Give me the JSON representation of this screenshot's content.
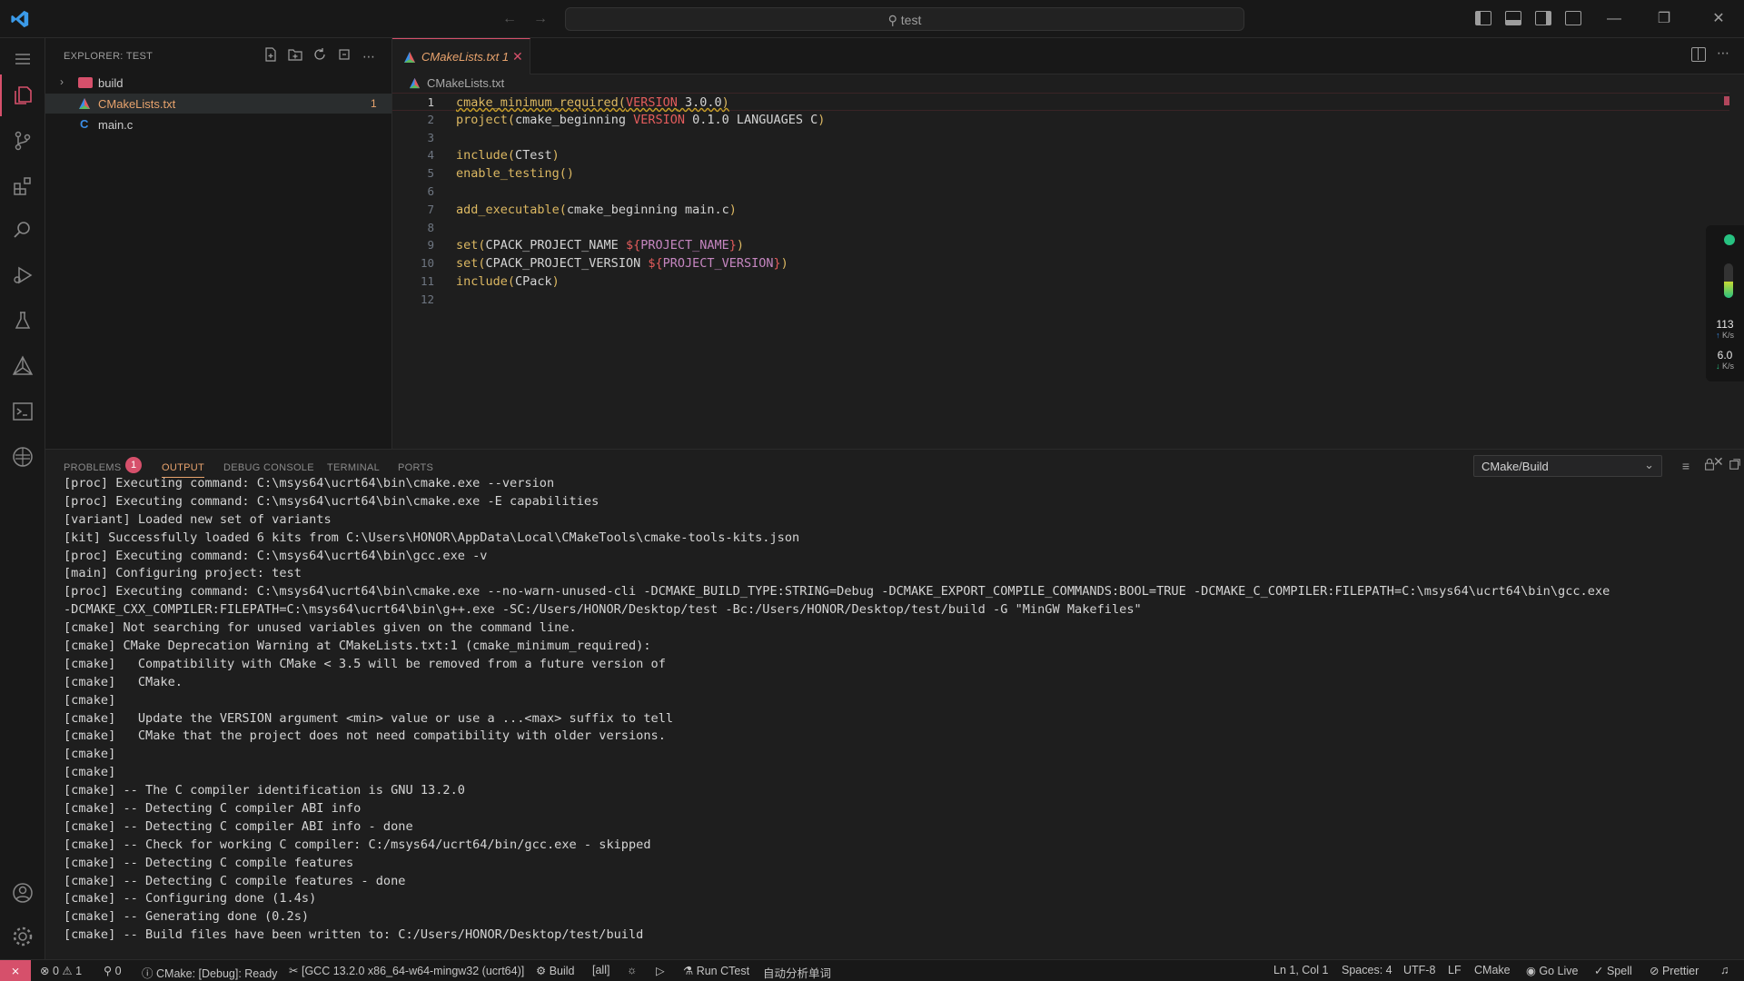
{
  "titlebar": {
    "search_text": "test",
    "nav_back": "←",
    "nav_forward": "→",
    "minimize": "—",
    "maximize": "❐",
    "close": "✕"
  },
  "sidebar": {
    "title": "EXPLORER: TEST",
    "items": [
      {
        "label": "build",
        "kind": "folder",
        "badge": ""
      },
      {
        "label": "CMakeLists.txt",
        "kind": "cmake",
        "badge": "1"
      },
      {
        "label": "main.c",
        "kind": "c",
        "badge": ""
      }
    ]
  },
  "editor": {
    "tab_label": "CMakeLists.txt 1",
    "breadcrumb": "CMakeLists.txt",
    "line_numbers": [
      "1",
      "2",
      "3",
      "4",
      "5",
      "6",
      "7",
      "8",
      "9",
      "10",
      "11",
      "12"
    ],
    "lines": [
      [
        {
          "t": "cmake_minimum_required(",
          "c": "fn"
        },
        {
          "t": "VERSION",
          "c": "kw"
        },
        {
          "t": " 3.0.0",
          "c": "pl"
        },
        {
          "t": ")",
          "c": "fn"
        }
      ],
      [
        {
          "t": "project(",
          "c": "fn"
        },
        {
          "t": "cmake_beginning ",
          "c": "pl"
        },
        {
          "t": "VERSION",
          "c": "kw"
        },
        {
          "t": " 0.1.0 LANGUAGES C",
          "c": "pl"
        },
        {
          "t": ")",
          "c": "fn"
        }
      ],
      [],
      [
        {
          "t": "include(",
          "c": "fn"
        },
        {
          "t": "CTest",
          "c": "pl"
        },
        {
          "t": ")",
          "c": "fn"
        }
      ],
      [
        {
          "t": "enable_testing()",
          "c": "fn"
        }
      ],
      [],
      [
        {
          "t": "add_executable(",
          "c": "fn"
        },
        {
          "t": "cmake_beginning main.c",
          "c": "pl"
        },
        {
          "t": ")",
          "c": "fn"
        }
      ],
      [],
      [
        {
          "t": "set(",
          "c": "fn"
        },
        {
          "t": "CPACK_PROJECT_NAME ",
          "c": "pl"
        },
        {
          "t": "${",
          "c": "kw"
        },
        {
          "t": "PROJECT_NAME",
          "c": "var"
        },
        {
          "t": "}",
          "c": "kw"
        },
        {
          "t": ")",
          "c": "fn"
        }
      ],
      [
        {
          "t": "set(",
          "c": "fn"
        },
        {
          "t": "CPACK_PROJECT_VERSION ",
          "c": "pl"
        },
        {
          "t": "${",
          "c": "kw"
        },
        {
          "t": "PROJECT_VERSION",
          "c": "var"
        },
        {
          "t": "}",
          "c": "kw"
        },
        {
          "t": ")",
          "c": "fn"
        }
      ],
      [
        {
          "t": "include(",
          "c": "fn"
        },
        {
          "t": "CPack",
          "c": "pl"
        },
        {
          "t": ")",
          "c": "fn"
        }
      ],
      []
    ]
  },
  "net_widget": {
    "upload_value": "113",
    "upload_unit": "K/s",
    "download_value": "6.0",
    "download_unit": "K/s"
  },
  "panel": {
    "tabs": [
      "PROBLEMS",
      "OUTPUT",
      "DEBUG CONSOLE",
      "TERMINAL",
      "PORTS"
    ],
    "problems_count": "1",
    "output_channel": "CMake/Build",
    "log": [
      "[proc] Executing command: C:\\msys64\\ucrt64\\bin\\cmake.exe --version",
      "[proc] Executing command: C:\\msys64\\ucrt64\\bin\\cmake.exe -E capabilities",
      "[variant] Loaded new set of variants",
      "[kit] Successfully loaded 6 kits from C:\\Users\\HONOR\\AppData\\Local\\CMakeTools\\cmake-tools-kits.json",
      "[proc] Executing command: C:\\msys64\\ucrt64\\bin\\gcc.exe -v",
      "[main] Configuring project: test",
      "[proc] Executing command: C:\\msys64\\ucrt64\\bin\\cmake.exe --no-warn-unused-cli -DCMAKE_BUILD_TYPE:STRING=Debug -DCMAKE_EXPORT_COMPILE_COMMANDS:BOOL=TRUE -DCMAKE_C_COMPILER:FILEPATH=C:\\msys64\\ucrt64\\bin\\gcc.exe",
      "-DCMAKE_CXX_COMPILER:FILEPATH=C:\\msys64\\ucrt64\\bin\\g++.exe -SC:/Users/HONOR/Desktop/test -Bc:/Users/HONOR/Desktop/test/build -G \"MinGW Makefiles\"",
      "[cmake] Not searching for unused variables given on the command line.",
      "[cmake] CMake Deprecation Warning at CMakeLists.txt:1 (cmake_minimum_required):",
      "[cmake]   Compatibility with CMake < 3.5 will be removed from a future version of",
      "[cmake]   CMake.",
      "[cmake]",
      "[cmake]   Update the VERSION argument <min> value or use a ...<max> suffix to tell",
      "[cmake]   CMake that the project does not need compatibility with older versions.",
      "[cmake]",
      "[cmake]",
      "[cmake] -- The C compiler identification is GNU 13.2.0",
      "[cmake] -- Detecting C compiler ABI info",
      "[cmake] -- Detecting C compiler ABI info - done",
      "[cmake] -- Check for working C compiler: C:/msys64/ucrt64/bin/gcc.exe - skipped",
      "[cmake] -- Detecting C compile features",
      "[cmake] -- Detecting C compile features - done",
      "[cmake] -- Configuring done (1.4s)",
      "[cmake] -- Generating done (0.2s)",
      "[cmake] -- Build files have been written to: C:/Users/HONOR/Desktop/test/build"
    ]
  },
  "statusbar": {
    "errors": "0",
    "warnings": "1",
    "ports": "0",
    "cmake_status": "CMake: [Debug]: Ready",
    "kit": "[GCC 13.2.0 x86_64-w64-mingw32 (ucrt64)]",
    "build": "Build",
    "target": "[all]",
    "run_ctest": "Run CTest",
    "extra": "自动分析单词",
    "position": "Ln 1, Col 1",
    "spaces": "Spaces: 4",
    "encoding": "UTF-8",
    "eol": "LF",
    "language": "CMake",
    "go_live": "Go Live",
    "spell": "Spell",
    "prettier": "Prettier"
  },
  "colors": {
    "accent": "#d6506b",
    "tab_text": "#e8a36d",
    "function": "#dcb862",
    "keyword": "#e35c5c"
  }
}
